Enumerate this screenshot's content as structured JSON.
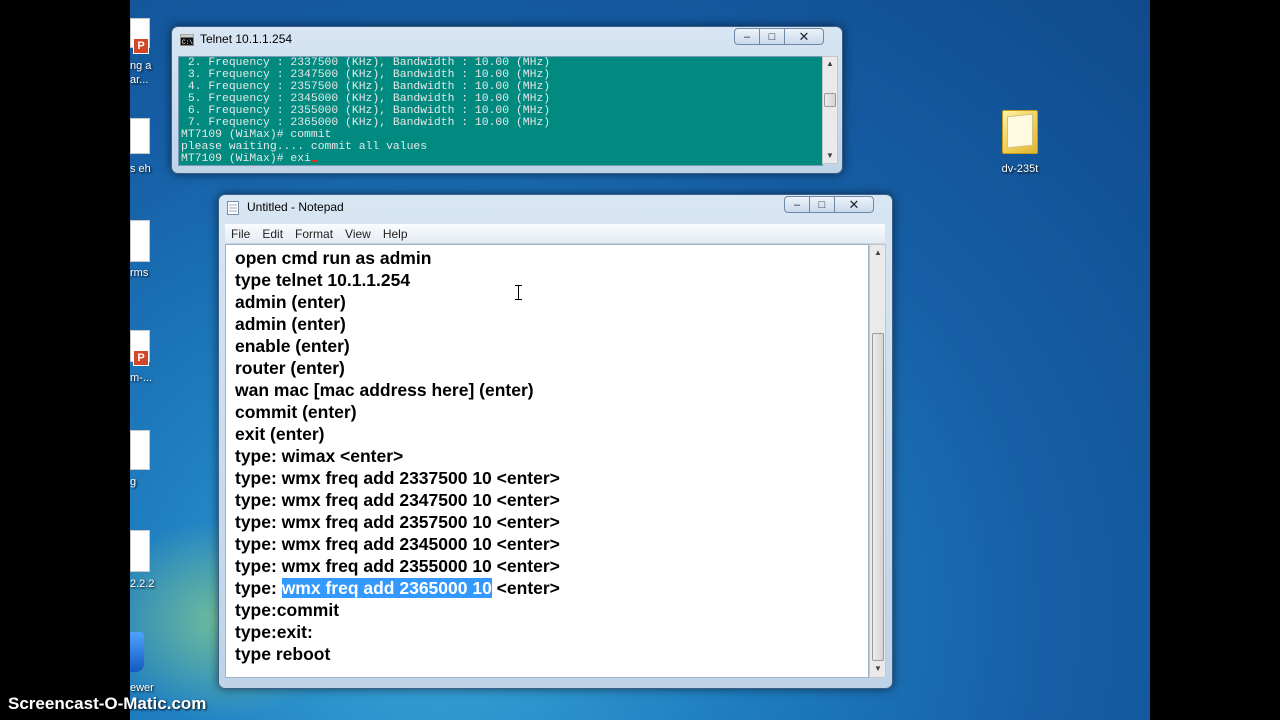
{
  "desktop": {
    "left_labels": [
      "ng a",
      "ar...",
      "s eh",
      "rms",
      "m-...",
      "g",
      "2.2.2",
      "ewer"
    ],
    "right_icon": {
      "name": "folder-icon",
      "label": "dv-235t"
    }
  },
  "telnet": {
    "title": "Telnet 10.1.1.254",
    "lines": [
      " 2. Frequency : 2337500 (KHz), Bandwidth : 10.00 (MHz)",
      " 3. Frequency : 2347500 (KHz), Bandwidth : 10.00 (MHz)",
      " 4. Frequency : 2357500 (KHz), Bandwidth : 10.00 (MHz)",
      " 5. Frequency : 2345000 (KHz), Bandwidth : 10.00 (MHz)",
      " 6. Frequency : 2355000 (KHz), Bandwidth : 10.00 (MHz)",
      " 7. Frequency : 2365000 (KHz), Bandwidth : 10.00 (MHz)",
      "MT7109 (WiMax)# commit",
      "please waiting.... commit all values",
      "MT7109 (WiMax)# exi"
    ]
  },
  "notepad": {
    "title": "Untitled - Notepad",
    "menu": [
      "File",
      "Edit",
      "Format",
      "View",
      "Help"
    ],
    "lines": [
      "open cmd run as admin",
      "type telnet 10.1.1.254",
      "admin (enter)",
      "admin (enter)",
      "enable (enter)",
      "router (enter)",
      "wan mac [mac address here] (enter)",
      "commit (enter)",
      "exit (enter)",
      "type: wimax <enter>",
      "type: wmx freq add 2337500 10 <enter>",
      "type: wmx freq add 2347500 10 <enter>",
      "type: wmx freq add 2357500 10 <enter>",
      "type: wmx freq add 2345000 10 <enter>",
      "type: wmx freq add 2355000 10 <enter>"
    ],
    "selected_line": {
      "before": "type: ",
      "selected": "wmx freq add 2365000 10",
      "after": " <enter>"
    },
    "lines_after": [
      "type:commit",
      "type:exit:",
      "type reboot"
    ]
  },
  "watermark": "Screencast-O-Matic.com",
  "colors": {
    "console_bg": "#008a80",
    "selection": "#3399ff"
  }
}
